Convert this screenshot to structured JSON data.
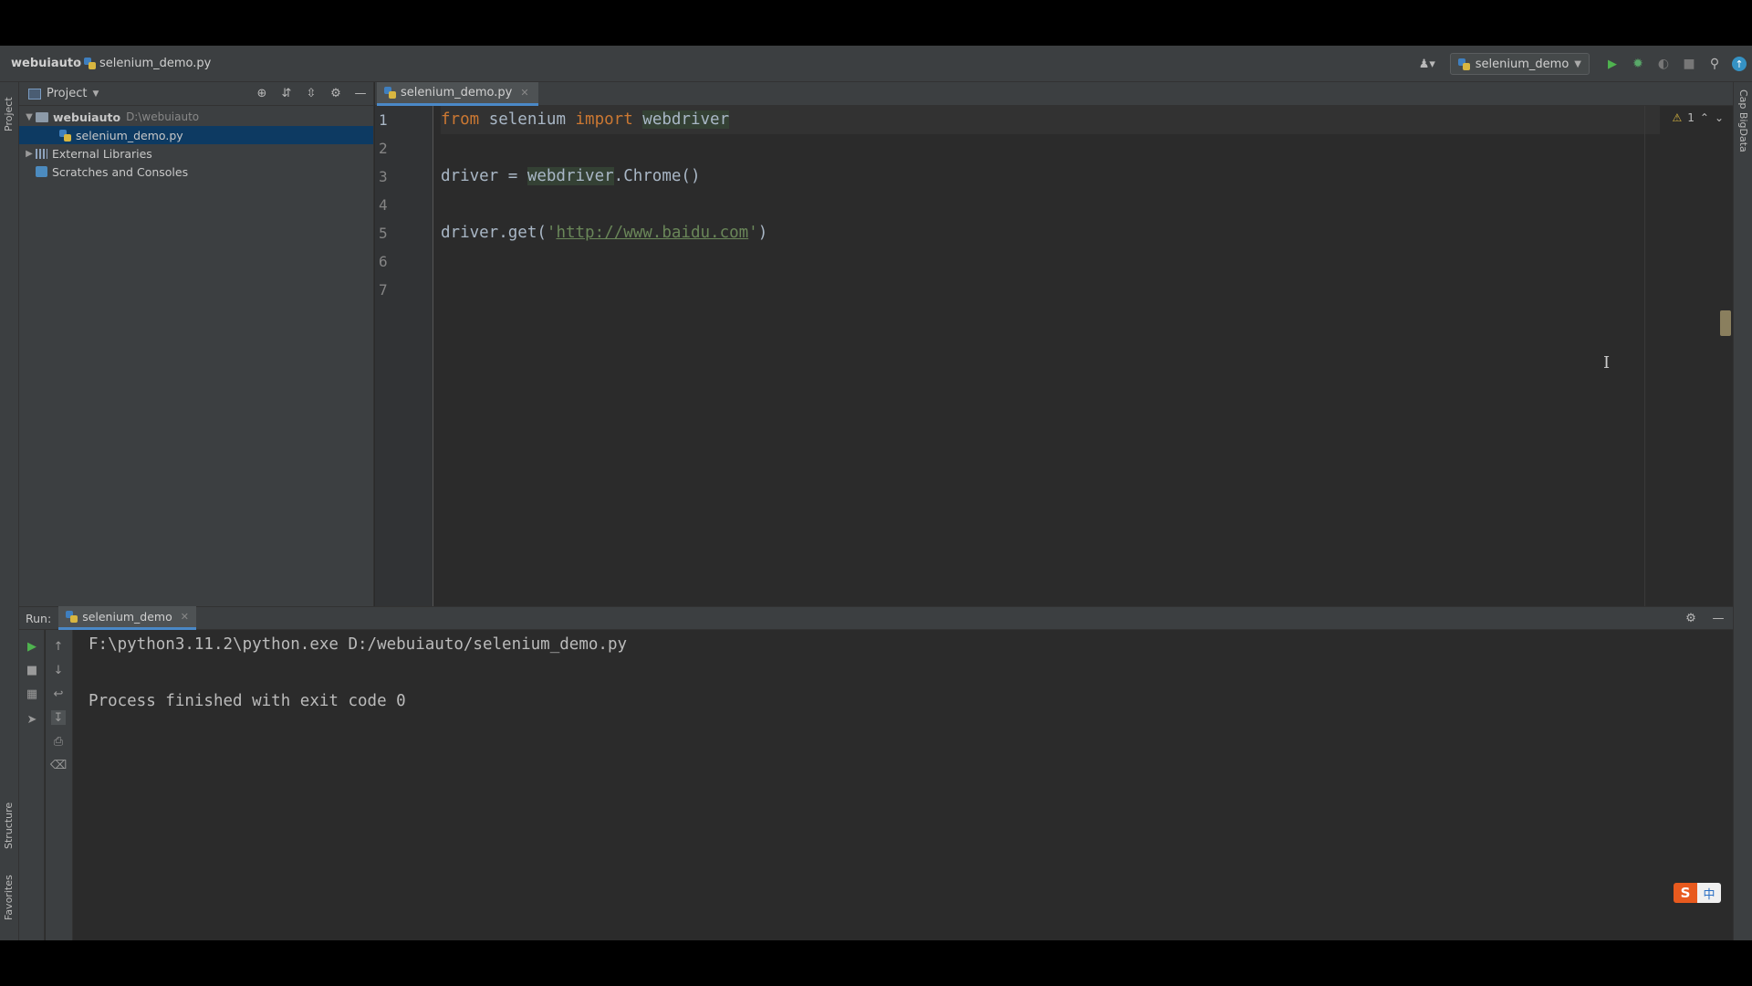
{
  "navbar": {
    "project_name": "webuiauto",
    "separator": "›",
    "file_name": "selenium_demo.py",
    "user_icon": "user-icon",
    "run_config_label": "selenium_demo",
    "icons": [
      "run-icon",
      "debug-icon",
      "coverage-icon",
      "stop-icon",
      "search-icon",
      "update-icon"
    ]
  },
  "left_stripe": {
    "project_label": "Project",
    "structure_label": "Structure",
    "favorites_label": "Favorites"
  },
  "right_stripe": {
    "bigdata_label": "Cap BigData"
  },
  "project_panel": {
    "title": "Project",
    "tree": [
      {
        "label": "webuiauto",
        "hint": "D:\\webuiauto",
        "icon": "folder-icon",
        "expanded": true
      },
      {
        "label": "selenium_demo.py",
        "icon": "python-file-icon",
        "selected": true
      },
      {
        "label": "External Libraries",
        "icon": "library-icon",
        "expanded": false
      },
      {
        "label": "Scratches and Consoles",
        "icon": "scratch-icon"
      }
    ]
  },
  "editor": {
    "tab_label": "selenium_demo.py",
    "line_numbers": [
      "1",
      "2",
      "3",
      "4",
      "5",
      "6",
      "7"
    ],
    "lines": {
      "l1": {
        "kw1": "from",
        "mod": " selenium ",
        "kw2": "import",
        "name": "webdriver"
      },
      "l3": {
        "var": "driver = ",
        "obj": "webdriver",
        "call": ".Chrome()"
      },
      "l5": {
        "pre": "driver.get(",
        "q1": "'",
        "url": "http://www.baidu.com",
        "q2": "'",
        "post": ")"
      }
    },
    "warning_count": "1"
  },
  "run_panel": {
    "label": "Run:",
    "tab_label": "selenium_demo",
    "console": [
      "F:\\python3.11.2\\python.exe D:/webuiauto/selenium_demo.py",
      "",
      "Process finished with exit code 0"
    ]
  },
  "ime": {
    "logo": "S",
    "mode": "中"
  }
}
